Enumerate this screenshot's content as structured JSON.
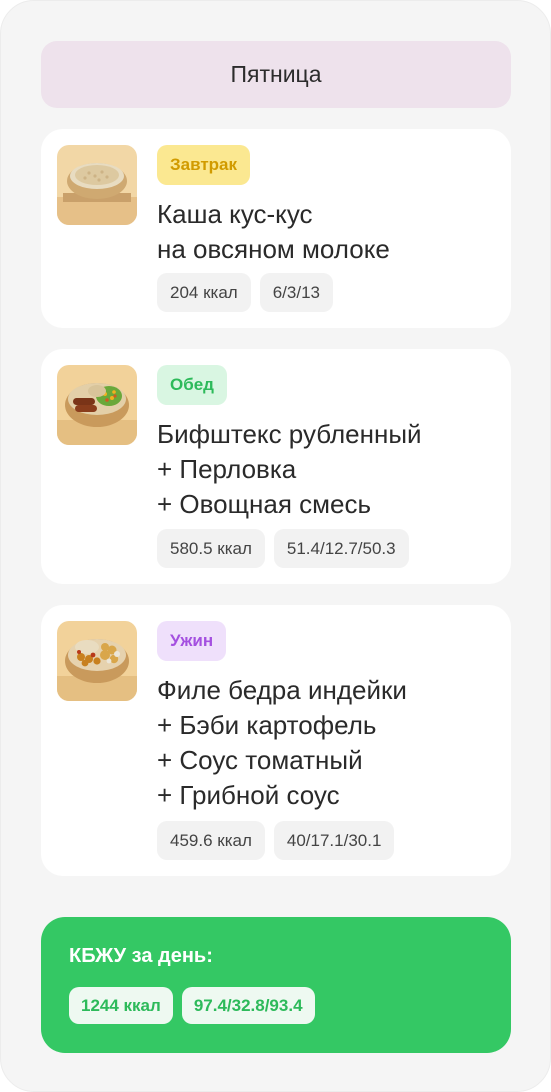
{
  "day": {
    "title": "Пятница"
  },
  "meals": [
    {
      "tag": "Завтрак",
      "tag_bg": "#fbe891",
      "tag_color": "#d19b00",
      "image": "couscous-porridge-bowl",
      "title_lines": [
        "Каша кус-кус",
        "на овсяном молоке"
      ],
      "kcal": "204 ккал",
      "macros": "6/3/13"
    },
    {
      "tag": "Обед",
      "tag_bg": "#d9f6e2",
      "tag_color": "#2dba5a",
      "image": "beef-barley-vegetables-bowl",
      "title_lines": [
        "Бифштекс рубленный",
        "+ Перловка",
        "+ Овощная смесь"
      ],
      "kcal": "580.5 ккал",
      "macros": "51.4/12.7/50.3"
    },
    {
      "tag": "Ужин",
      "tag_bg": "#efe0fb",
      "tag_color": "#a450e0",
      "image": "turkey-potatoes-mushrooms-bowl",
      "title_lines": [
        "Филе бедра индейки",
        "+ Бэби картофель",
        "+ Соус томатный",
        "+ Грибной соус"
      ],
      "kcal": "459.6 ккал",
      "macros": "40/17.1/30.1"
    }
  ],
  "summary": {
    "title": "КБЖУ за день:",
    "kcal": "1244 ккал",
    "macros": "97.4/32.8/93.4",
    "bg": "#34c864"
  }
}
